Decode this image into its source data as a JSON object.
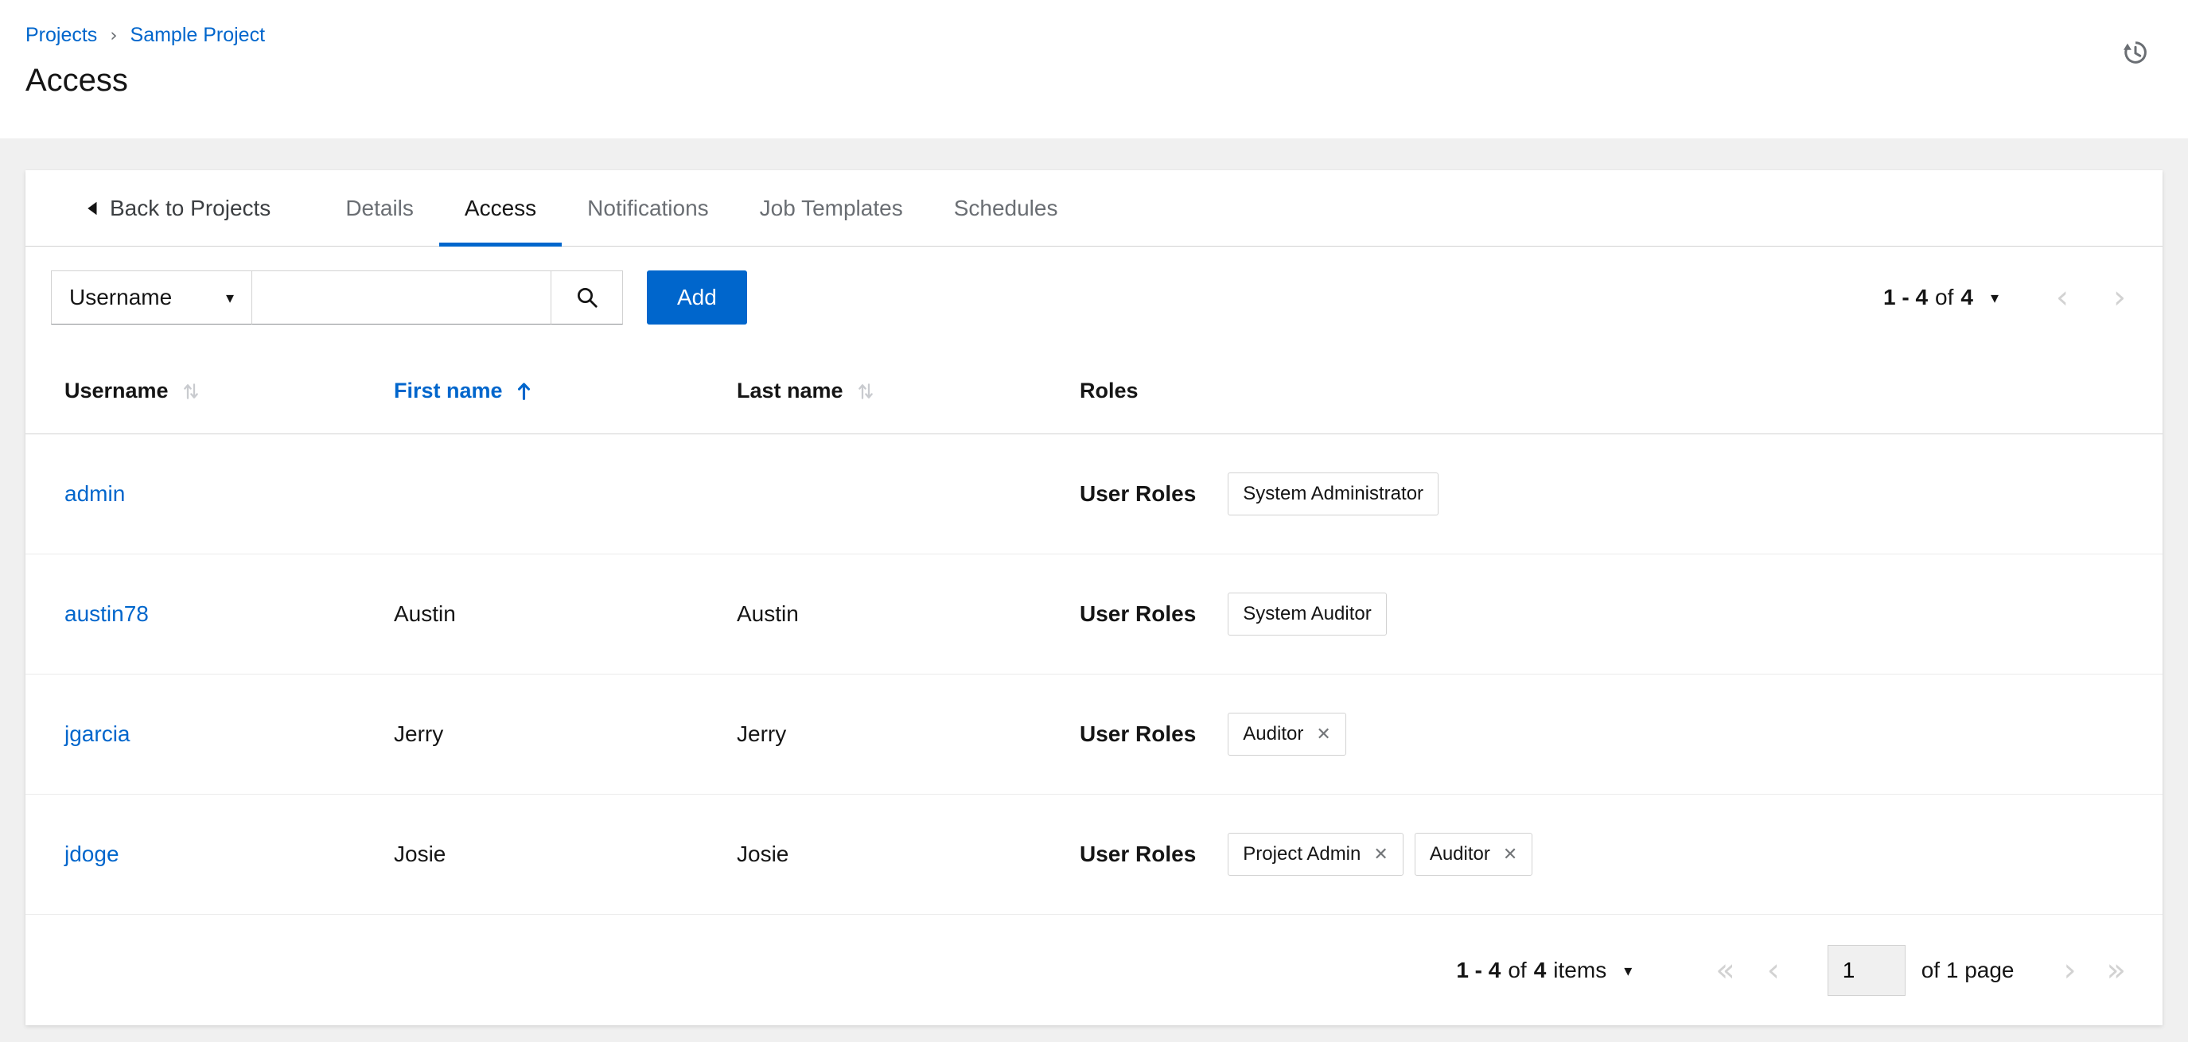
{
  "icons": {
    "caret_down": "▾",
    "close_x": "✕",
    "angle_left": "‹",
    "angle_right": "›",
    "angle_double_left": "«",
    "angle_double_right": "»"
  },
  "colors": {
    "accent": "#0066cc",
    "link": "#0066cc",
    "active_tab_underline": "#0066cc"
  },
  "breadcrumb": {
    "projects": "Projects",
    "separator": "›",
    "current": "Sample Project"
  },
  "page": {
    "title": "Access"
  },
  "tabs": {
    "back_label": "Back to Projects",
    "active_tab": "Access",
    "items": [
      {
        "label": "Details"
      },
      {
        "label": "Access"
      },
      {
        "label": "Notifications"
      },
      {
        "label": "Job Templates"
      },
      {
        "label": "Schedules"
      }
    ]
  },
  "toolbar": {
    "filter_selected": "Username",
    "search_value": "",
    "add_label": "Add",
    "pagination": {
      "range": "1 - 4",
      "of": "of",
      "total": "4"
    }
  },
  "table": {
    "headers": {
      "username": "Username",
      "first_name": "First name",
      "last_name": "Last name",
      "roles": "Roles"
    },
    "sorted_by": "First name",
    "sort_direction": "ascending",
    "roles_label": "User Roles",
    "rows": [
      {
        "username": "admin",
        "first_name": "",
        "last_name": "",
        "chips": [
          {
            "label": "System Administrator",
            "removable": false
          }
        ]
      },
      {
        "username": "austin78",
        "first_name": "Austin",
        "last_name": "Austin",
        "chips": [
          {
            "label": "System Auditor",
            "removable": false
          }
        ]
      },
      {
        "username": "jgarcia",
        "first_name": "Jerry",
        "last_name": "Jerry",
        "chips": [
          {
            "label": "Auditor",
            "removable": true
          }
        ]
      },
      {
        "username": "jdoge",
        "first_name": "Josie",
        "last_name": "Josie",
        "chips": [
          {
            "label": "Project Admin",
            "removable": true
          },
          {
            "label": "Auditor",
            "removable": true
          }
        ]
      }
    ]
  },
  "footer": {
    "items_range": "1 - 4",
    "items_of": "of",
    "items_total": "4",
    "items_word": "items",
    "current_page": "1",
    "page_of_label": "of 1 page"
  }
}
